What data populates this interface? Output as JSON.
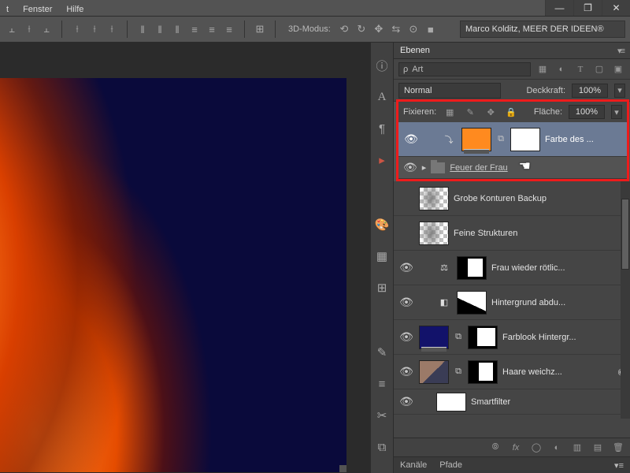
{
  "menu": {
    "fenster": "Fenster",
    "hilfe": "Hilfe",
    "cut_left": "t"
  },
  "window": {
    "min": "—",
    "max": "❐",
    "close": "✕"
  },
  "options": {
    "modus_label": "3D-Modus:",
    "credit": "Marco Kolditz, MEER DER IDEEN®",
    "chev": "▾"
  },
  "panels": {
    "ebenen_tab": "Ebenen",
    "search_mode": "Art",
    "search_icon": "ρ",
    "blend_mode": "Normal",
    "opacity_label": "Deckkraft:",
    "opacity_value": "100%",
    "fill_label": "Fläche:",
    "fill_value": "100%",
    "lock_label": "Fixieren:"
  },
  "layers": {
    "l1_name": "Farbe des ...",
    "group_name": "Feuer der Frau",
    "l3_name": "Grobe Konturen Backup",
    "l4_name": "Feine Strukturen",
    "l5_name": "Frau wieder rötlic...",
    "l6_name": "Hintergrund abdu...",
    "l7_name": "Farblook Hintergr...",
    "l8_name": "Haare weichz...",
    "l9_name": "Smartfilter"
  },
  "footer": {
    "link": "⦾",
    "fx": "fx",
    "mask": "◯",
    "adj": "◐",
    "folder": "▥",
    "new": "▤",
    "trash": "🗑"
  },
  "tabs": {
    "kanäle": "Kanäle",
    "pfade": "Pfade"
  },
  "eye": "👁",
  "dd": "≑",
  "more": "▾≡",
  "tri_right": "▸"
}
